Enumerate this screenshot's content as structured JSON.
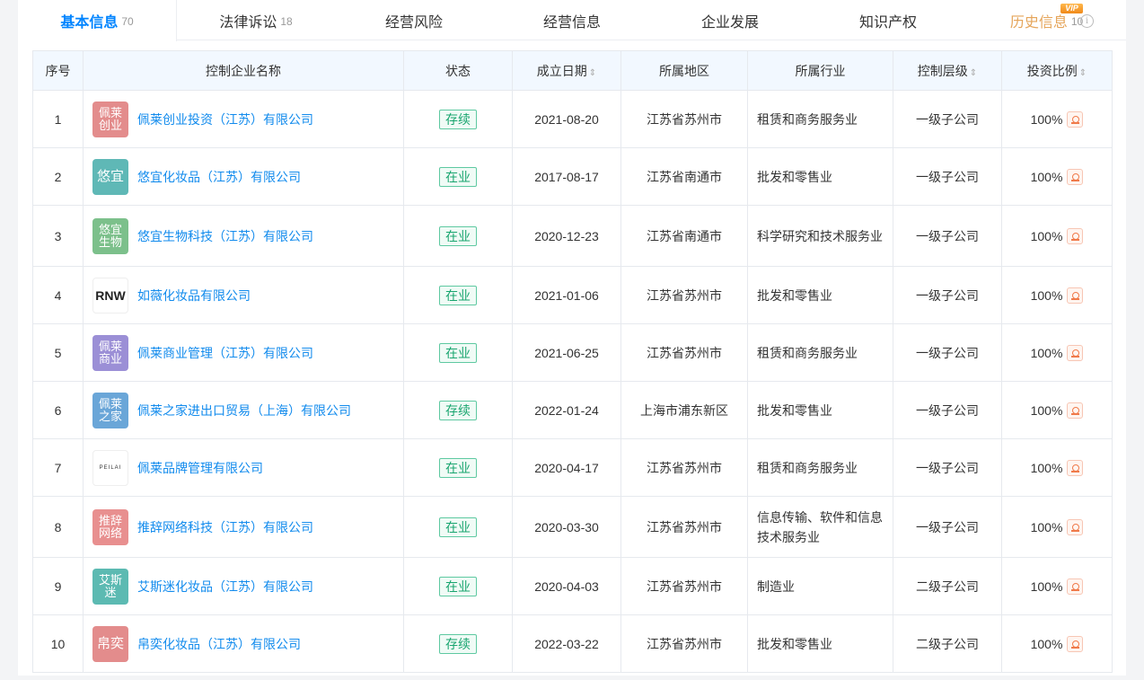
{
  "tabs": [
    {
      "label": "基本信息",
      "count": "70",
      "active": true
    },
    {
      "label": "法律诉讼",
      "count": "18"
    },
    {
      "label": "经营风险",
      "count": ""
    },
    {
      "label": "经营信息",
      "count": ""
    },
    {
      "label": "企业发展",
      "count": ""
    },
    {
      "label": "知识产权",
      "count": ""
    },
    {
      "label": "历史信息",
      "count": "10",
      "vip": "VIP"
    }
  ],
  "table": {
    "headers": {
      "index": "序号",
      "name": "控制企业名称",
      "status": "状态",
      "date": "成立日期",
      "region": "所属地区",
      "industry": "所属行业",
      "level": "控制层级",
      "ratio": "投资比例"
    },
    "sort_icon": "⇕",
    "rows": [
      {
        "index": "1",
        "logo": "佩莱\n创业",
        "logo_color": "#e38c8c",
        "name": "佩莱创业投资（江苏）有限公司",
        "status": "存续",
        "date": "2021-08-20",
        "region": "江苏省苏州市",
        "industry": "租赁和商务服务业",
        "level": "一级子公司",
        "ratio": "100%"
      },
      {
        "index": "2",
        "logo": "悠宜",
        "logo_color": "#5fb8b6",
        "name": "悠宜化妆品（江苏）有限公司",
        "status": "在业",
        "date": "2017-08-17",
        "region": "江苏省南通市",
        "industry": "批发和零售业",
        "level": "一级子公司",
        "ratio": "100%"
      },
      {
        "index": "3",
        "logo": "悠宜\n生物",
        "logo_color": "#7cc08b",
        "name": "悠宜生物科技（江苏）有限公司",
        "status": "在业",
        "date": "2020-12-23",
        "region": "江苏省南通市",
        "industry": "科学研究和技术服务业",
        "level": "一级子公司",
        "ratio": "100%"
      },
      {
        "index": "4",
        "logo": "RNW",
        "logo_color": "#ffffff",
        "name": "如薇化妆品有限公司",
        "status": "在业",
        "date": "2021-01-06",
        "region": "江苏省苏州市",
        "industry": "批发和零售业",
        "level": "一级子公司",
        "ratio": "100%"
      },
      {
        "index": "5",
        "logo": "佩莱\n商业",
        "logo_color": "#9b8fd6",
        "name": "佩莱商业管理（江苏）有限公司",
        "status": "在业",
        "date": "2021-06-25",
        "region": "江苏省苏州市",
        "industry": "租赁和商务服务业",
        "level": "一级子公司",
        "ratio": "100%"
      },
      {
        "index": "6",
        "logo": "佩莱\n之家",
        "logo_color": "#6aa6d8",
        "name": "佩莱之家进出口贸易（上海）有限公司",
        "status": "存续",
        "date": "2022-01-24",
        "region": "上海市浦东新区",
        "industry": "批发和零售业",
        "level": "一级子公司",
        "ratio": "100%"
      },
      {
        "index": "7",
        "logo": "PEILAI",
        "logo_color": "#ffffff",
        "name": "佩莱品牌管理有限公司",
        "status": "在业",
        "date": "2020-04-17",
        "region": "江苏省苏州市",
        "industry": "租赁和商务服务业",
        "level": "一级子公司",
        "ratio": "100%"
      },
      {
        "index": "8",
        "logo": "推辞\n网络",
        "logo_color": "#e88f8f",
        "name": "推辞网络科技（江苏）有限公司",
        "status": "在业",
        "date": "2020-03-30",
        "region": "江苏省苏州市",
        "industry": "信息传输、软件和信息技术服务业",
        "level": "一级子公司",
        "ratio": "100%"
      },
      {
        "index": "9",
        "logo": "艾斯\n迷",
        "logo_color": "#5cbab2",
        "name": "艾斯迷化妆品（江苏）有限公司",
        "status": "在业",
        "date": "2020-04-03",
        "region": "江苏省苏州市",
        "industry": "制造业",
        "level": "二级子公司",
        "ratio": "100%"
      },
      {
        "index": "10",
        "logo": "帛奕",
        "logo_color": "#e38c8c",
        "name": "帛奕化妆品（江苏）有限公司",
        "status": "存续",
        "date": "2022-03-22",
        "region": "江苏省苏州市",
        "industry": "批发和零售业",
        "level": "二级子公司",
        "ratio": "100%"
      }
    ]
  }
}
